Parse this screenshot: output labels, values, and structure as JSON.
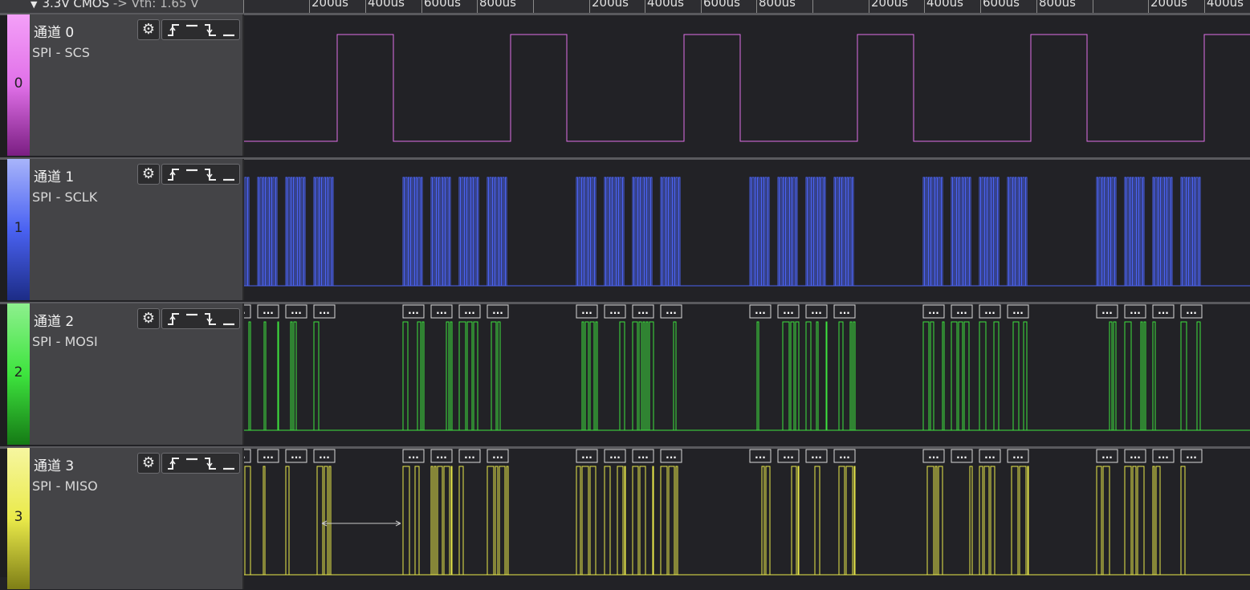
{
  "header": {
    "voltage_mode": "3.3V CMOS",
    "threshold": "-> Vth: 1.65 V",
    "tick_labels": [
      "200us",
      "400us",
      "600us",
      "800us",
      "200us",
      "400us",
      "600us",
      "800us",
      "200us",
      "400us",
      "600us",
      "800us",
      "200us",
      "400us"
    ]
  },
  "channels": [
    {
      "index": "0",
      "name": "通道 0",
      "protocol": "SPI - SCS",
      "color": "#e070e8",
      "strip_top": "#f4a0f8",
      "strip_bottom": "#7a1e82"
    },
    {
      "index": "1",
      "name": "通道 1",
      "protocol": "SPI - SCLK",
      "color": "#4a62f2",
      "strip_top": "#a8b4fa",
      "strip_bottom": "#1c2c86"
    },
    {
      "index": "2",
      "name": "通道 2",
      "protocol": "SPI - MOSI",
      "color": "#3ee43e",
      "strip_top": "#8ef08e",
      "strip_bottom": "#157a15"
    },
    {
      "index": "3",
      "name": "通道 3",
      "protocol": "SPI - MISO",
      "color": "#eaea4a",
      "strip_top": "#f6f6a0",
      "strip_bottom": "#7e7e16"
    }
  ],
  "icons": {
    "settings": "gear-icon",
    "rising_edge": "rising-edge-icon",
    "high_level": "high-level-icon",
    "falling_edge": "falling-edge-icon",
    "low_level": "low-level-icon"
  },
  "decoder_badge_text": "...",
  "colors": {
    "background": "#222226",
    "panel": "#444447"
  }
}
